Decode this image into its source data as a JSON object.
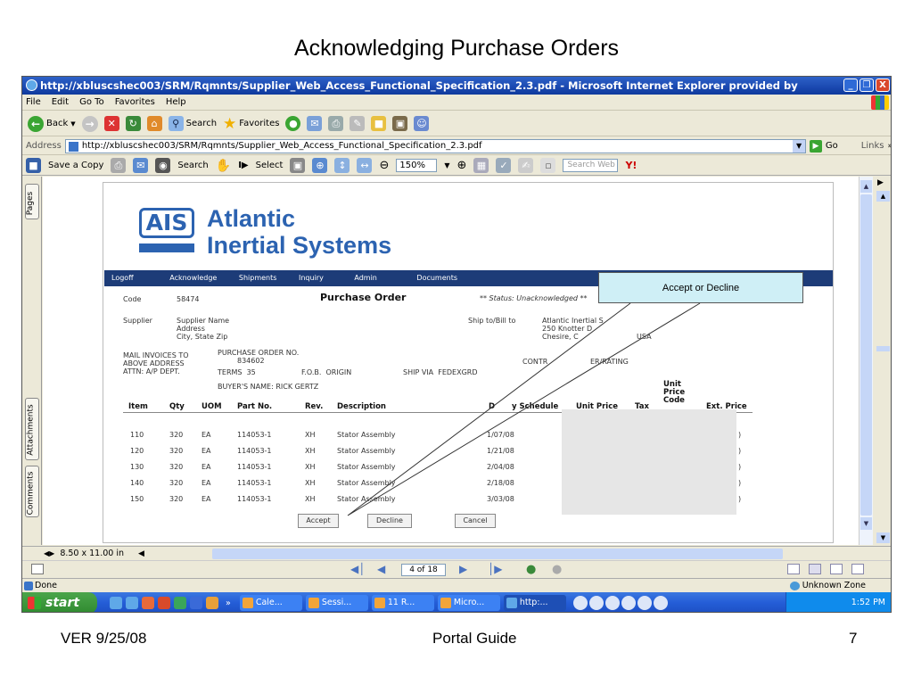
{
  "slide": {
    "title": "Acknowledging Purchase Orders",
    "footer_left": "VER 9/25/08",
    "footer_center": "Portal Guide",
    "footer_right": "7"
  },
  "window": {
    "title": "http://xbluscshec003/SRM/Rqmnts/Supplier_Web_Access_Functional_Specification_2.3.pdf - Microsoft Internet Explorer provided by",
    "buttons": [
      "_",
      "❒",
      "X"
    ]
  },
  "menu": [
    "File",
    "Edit",
    "Go To",
    "Favorites",
    "Help"
  ],
  "toolbar": {
    "back": "Back",
    "search": "Search",
    "favorites": "Favorites"
  },
  "address": {
    "label": "Address",
    "url": "http://xbluscshec003/SRM/Rqmnts/Supplier_Web_Access_Functional_Specification_2.3.pdf",
    "go": "Go",
    "links": "Links"
  },
  "pdf_toolbar": {
    "save_copy": "Save a Copy",
    "search": "Search",
    "select": "Select",
    "zoom": "150%",
    "search_web_placeholder": "Search Web"
  },
  "side_tabs": [
    "Pages",
    "Attachments",
    "Comments"
  ],
  "document": {
    "logo_mark": "AIS",
    "logo_line1": "Atlantic",
    "logo_line2": "Inertial Systems",
    "nav": [
      "Logoff",
      "Acknowledge",
      "Shipments",
      "Inquiry",
      "Admin",
      "Documents"
    ],
    "code_label": "Code",
    "code_value": "58474",
    "po_heading": "Purchase Order",
    "status": "** Status: Unacknowledged **",
    "supplier_label": "Supplier",
    "supplier_lines": [
      "Supplier Name",
      "Address",
      "City, State Zip"
    ],
    "ship_label": "Ship to/Bill to",
    "ship_lines": [
      "Atlantic Inertial S",
      "250 Knotter D",
      "Chesire, C",
      "USA"
    ],
    "mail_lines": [
      "MAIL INVOICES TO",
      "ABOVE ADDRESS",
      "ATTN: A/P DEPT."
    ],
    "po_no_label": "PURCHASE ORDER NO.",
    "po_no_value": "834602",
    "terms": "TERMS  35",
    "fob": "F.O.B.  ORIGIN",
    "shipvia": "SHIP VIA  FEDEXGRD",
    "contr": "CONTR",
    "contr_rest": "ER/RATING",
    "buyer": "BUYER'S NAME: RICK GERTZ",
    "columns": [
      "Item",
      "Qty",
      "UOM",
      "Part No.",
      "Rev.",
      "Description",
      "D",
      "y Schedule",
      "Unit Price",
      "Tax",
      "Unit Price Code",
      "Ext. Price"
    ],
    "rows": [
      {
        "item": "110",
        "qty": "320",
        "uom": "EA",
        "part": "114053-1",
        "rev": "XH",
        "desc": "Stator Assembly",
        "sched": "1/07/08",
        "ext": ")"
      },
      {
        "item": "120",
        "qty": "320",
        "uom": "EA",
        "part": "114053-1",
        "rev": "XH",
        "desc": "Stator Assembly",
        "sched": "1/21/08",
        "ext": ")"
      },
      {
        "item": "130",
        "qty": "320",
        "uom": "EA",
        "part": "114053-1",
        "rev": "XH",
        "desc": "Stator Assembly",
        "sched": "2/04/08",
        "ext": ")"
      },
      {
        "item": "140",
        "qty": "320",
        "uom": "EA",
        "part": "114053-1",
        "rev": "XH",
        "desc": "Stator Assembly",
        "sched": "2/18/08",
        "ext": ")"
      },
      {
        "item": "150",
        "qty": "320",
        "uom": "EA",
        "part": "114053-1",
        "rev": "XH",
        "desc": "Stator Assembly",
        "sched": "3/03/08",
        "ext": ")"
      }
    ],
    "buttons": {
      "accept": "Accept",
      "decline": "Decline",
      "cancel": "Cancel"
    }
  },
  "callout": "Accept or Decline",
  "bottom": {
    "page_size": "8.50 x 11.00 in",
    "page_of": "4 of 18"
  },
  "status": {
    "text": "Done",
    "zone": "Unknown Zone"
  },
  "taskbar": {
    "start": "start",
    "tasks": [
      "Cale...",
      "Sessi...",
      "11 R...",
      "Micro...",
      "http:..."
    ],
    "time": "1:52 PM"
  }
}
